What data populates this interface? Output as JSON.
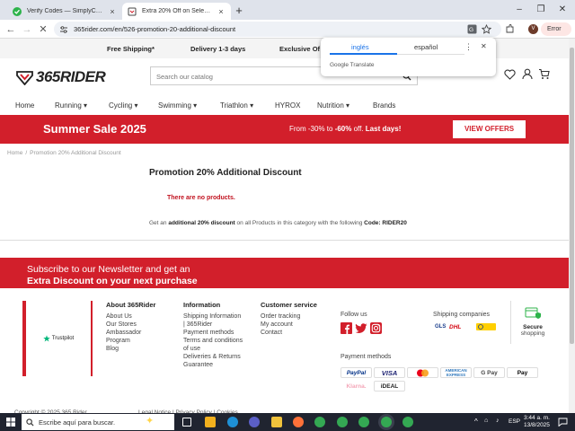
{
  "browser": {
    "tabs": [
      {
        "title": "Verify Codes — SimplyCodes",
        "active": false
      },
      {
        "title": "Extra 20% Off on Selected Runn",
        "active": true
      }
    ],
    "url": "365rider.com/en/526-promotion-20-additional-discount",
    "error_label": "Error",
    "avatar_letter": "V"
  },
  "translate_popup": {
    "lang_source": "inglés",
    "lang_target": "español",
    "branding": "Google Translate"
  },
  "shipping_strip": {
    "items": [
      "Free Shipping*",
      "Delivery 1-3 days",
      "Exclusive Of"
    ]
  },
  "header": {
    "logo_text": "365RIDER",
    "search_placeholder": "Search our catalog"
  },
  "nav": {
    "items": [
      "Home",
      "Running",
      "Cycling",
      "Swimming",
      "Triathlon",
      "HYROX",
      "Nutrition",
      "Brands"
    ]
  },
  "sale_banner": {
    "title": "Summer Sale 2025",
    "promo_prefix": "From -30% to ",
    "promo_bold": "-60%",
    "promo_mid": " off. ",
    "promo_end": "Last days!",
    "button": "VIEW OFFERS"
  },
  "breadcrumb": [
    "Home",
    "Promotion 20% Additional Discount"
  ],
  "main": {
    "title": "Promotion 20% Additional Discount",
    "no_products": "There are no products.",
    "info_prefix": "Get an ",
    "info_bold": "additional 20% discount",
    "info_mid": " on all Products in this category with the following ",
    "info_code": "Code: RIDER20"
  },
  "newsletter": {
    "line1": "Subscribe to our Newsletter and get an",
    "line2": "Extra Discount on your next purchase"
  },
  "footer": {
    "trustpilot": "Trustpilot",
    "about": {
      "title": "About 365Rider",
      "links": [
        "About Us",
        "Our Stores",
        "Ambassador",
        "Program",
        "Blog"
      ]
    },
    "information": {
      "title": "Information",
      "links": [
        "Shipping Information",
        "| 365Rider",
        "Payment methods",
        "Terms and conditions",
        "of use",
        "Deliveries & Returns",
        "Guarantee"
      ]
    },
    "customer_service": {
      "title": "Customer service",
      "links": [
        "Order tracking",
        "My account",
        "Contact"
      ]
    },
    "follow_us": "Follow us",
    "shipping_companies": "Shipping companies",
    "carriers": [
      "GLS",
      "DHL"
    ],
    "secure": {
      "line1": "Secure",
      "line2": "shopping"
    },
    "payment_methods": "Payment methods",
    "payments": [
      "PayPal",
      "VISA",
      "AMERICAN EXPRESS",
      "G Pay",
      "Pay",
      "Klarna.",
      "iDEAL"
    ],
    "copyright": "Copyright © 2025 365 Rider",
    "legal": [
      "Legal Notice",
      "Privacy Policy",
      "Cookies"
    ]
  },
  "taskbar": {
    "search_placeholder": "Escribe aquí para buscar.",
    "lang": "ESP",
    "time": "3:44 a. m.",
    "date": "13/8/2025"
  },
  "colors": {
    "brand_red": "#d21f2b",
    "chrome_tab_bg": "#dfe3eb",
    "taskbar": "#202430"
  }
}
